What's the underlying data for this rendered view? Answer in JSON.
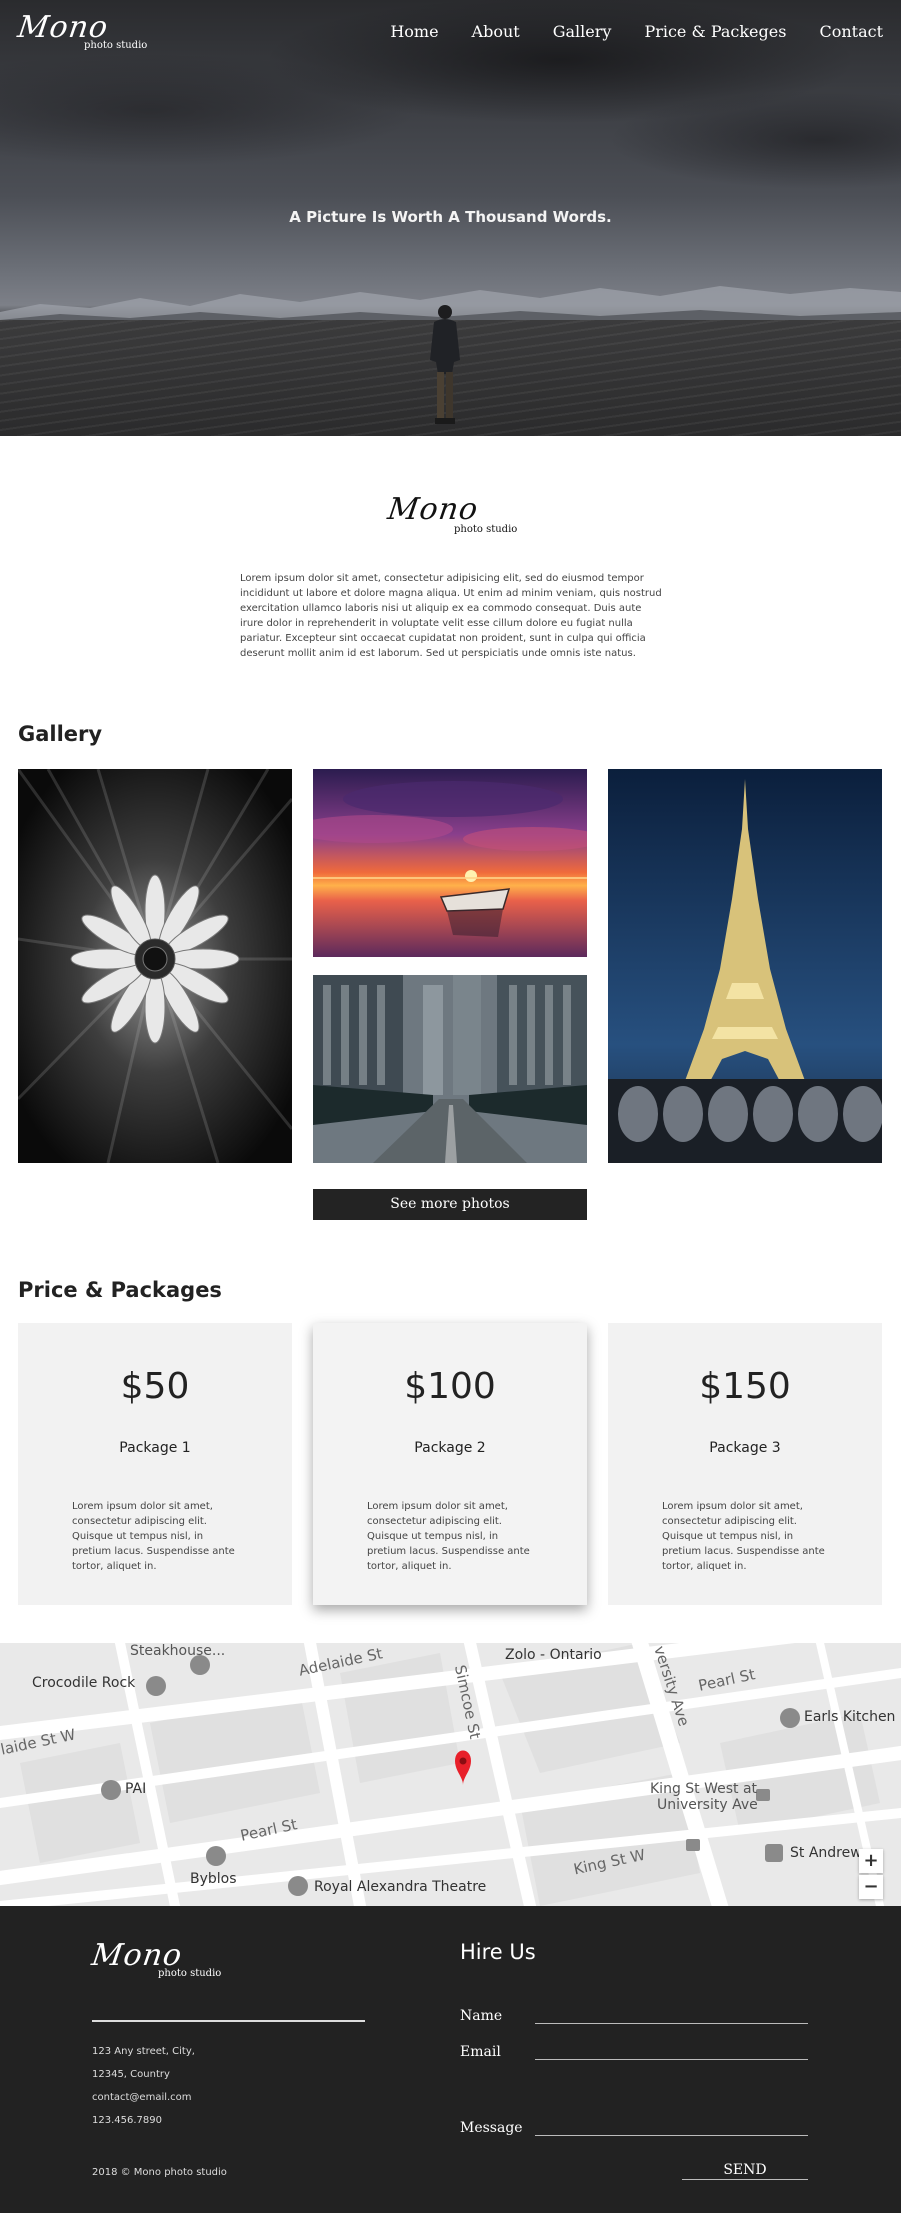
{
  "brand": {
    "script": "Mono",
    "sub": "photo studio"
  },
  "nav": [
    "Home",
    "About",
    "Gallery",
    "Price & Packeges",
    "Contact"
  ],
  "hero": {
    "tagline": "A Picture Is Worth A Thousand Words."
  },
  "about": {
    "text": "Lorem ipsum dolor sit amet, consectetur adipisicing elit, sed do eiusmod tempor incididunt ut labore et dolore magna aliqua. Ut enim ad minim veniam, quis nostrud exercitation ullamco laboris nisi ut aliquip ex ea commodo consequat. Duis aute irure dolor in reprehenderit in voluptate velit esse cillum dolore eu fugiat nulla pariatur. Excepteur sint occaecat cupidatat non proident, sunt in culpa qui officia deserunt mollit anim id est laborum. Sed ut perspiciatis unde omnis iste natus."
  },
  "gallery": {
    "title": "Gallery",
    "more_button": "See more photos"
  },
  "prices": {
    "title": "Price & Packages",
    "cards": [
      {
        "price": "$50",
        "name": "Package 1",
        "desc": "Lorem ipsum dolor sit amet, consectetur adipiscing elit. Quisque ut tempus nisl, in pretium lacus. Suspendisse ante tortor, aliquet in."
      },
      {
        "price": "$100",
        "name": "Package 2",
        "desc": "Lorem ipsum dolor sit amet, consectetur adipiscing elit. Quisque ut tempus nisl, in pretium lacus. Suspendisse ante tortor, aliquet in."
      },
      {
        "price": "$150",
        "name": "Package 3",
        "desc": "Lorem ipsum dolor sit amet, consectetur adipiscing elit. Quisque ut tempus nisl, in pretium lacus. Suspendisse ante tortor, aliquet in."
      }
    ]
  },
  "map": {
    "labels": {
      "steakhouse": "Steakhouse...",
      "adelaide_upper": "Adelaide St",
      "zolo": "Zolo - Ontario",
      "versity": "versity Ave",
      "crocodile": "Crocodile Rock",
      "pearl_upper": "Pearl St",
      "earls": "Earls Kitchen",
      "adelaide_left": "laide St W",
      "simcoe": "Simcoe St",
      "pai": "PAI",
      "king_west": "King St West at",
      "university": "University Ave",
      "pearl_lower": "Pearl St",
      "st_andrew": "St Andrew",
      "king_st": "King St W",
      "byblos": "Byblos",
      "royal": "Royal Alexandra Theatre"
    },
    "zoom_in": "+",
    "zoom_out": "−",
    "colors": {
      "pin": "#e8202a",
      "road": "#ffffff",
      "block": "#e4e4e4"
    }
  },
  "footer": {
    "address": [
      "123 Any street, City,",
      "12345, Country",
      "contact@email.com",
      "123.456.7890"
    ],
    "copyright": "2018 © Mono photo studio",
    "hire_title": "Hire Us",
    "fields": {
      "name": "Name",
      "email": "Email",
      "message": "Message"
    },
    "send": "SEND"
  }
}
